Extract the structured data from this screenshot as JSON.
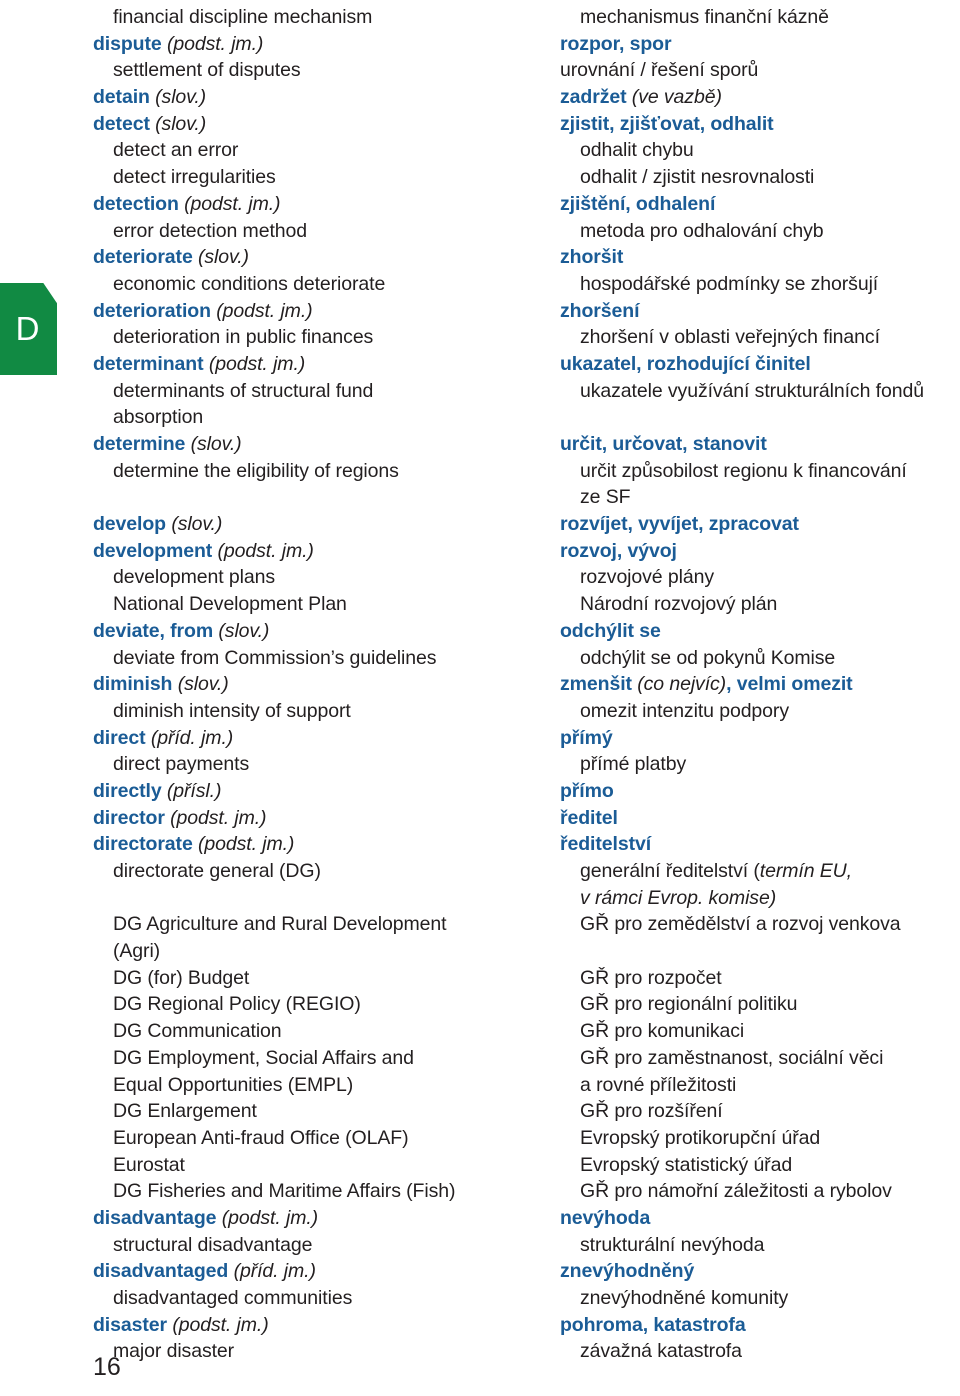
{
  "page": {
    "folio": "16",
    "thumb_index_letter": "D",
    "accent_blue": "#1b5c96",
    "tab_green": "#118a43",
    "body_color": "#231f20"
  },
  "rows": [
    {
      "en": [
        {
          "t": "financial discipline mechanism",
          "s": "plain"
        }
      ],
      "en_indent": true,
      "cs": [
        {
          "t": "mechanismus finanční kázně",
          "s": "plain"
        }
      ],
      "cs_indent": true
    },
    {
      "en": [
        {
          "t": "dispute",
          "s": "hw"
        },
        {
          "t": " (podst. jm.)",
          "s": "pos"
        }
      ],
      "en_indent": false,
      "cs": [
        {
          "t": "rozpor, spor",
          "s": "hw"
        }
      ],
      "cs_indent": false
    },
    {
      "en": [
        {
          "t": "settlement of disputes",
          "s": "plain"
        }
      ],
      "en_indent": true,
      "cs": [
        {
          "t": "urovnání / řešení sporů",
          "s": "plain"
        }
      ],
      "cs_indent": false
    },
    {
      "en": [
        {
          "t": "detain",
          "s": "hw"
        },
        {
          "t": " (slov.)",
          "s": "pos"
        }
      ],
      "en_indent": false,
      "cs": [
        {
          "t": "zadržet",
          "s": "hw"
        },
        {
          "t": " (ve vazbě)",
          "s": "pos"
        }
      ],
      "cs_indent": false
    },
    {
      "en": [
        {
          "t": "detect",
          "s": "hw"
        },
        {
          "t": " (slov.)",
          "s": "pos"
        }
      ],
      "en_indent": false,
      "cs": [
        {
          "t": "zjistit, zjišťovat, odhalit",
          "s": "hw"
        }
      ],
      "cs_indent": false
    },
    {
      "en": [
        {
          "t": "detect an error",
          "s": "plain"
        }
      ],
      "en_indent": true,
      "cs": [
        {
          "t": "odhalit chybu",
          "s": "plain"
        }
      ],
      "cs_indent": true
    },
    {
      "en": [
        {
          "t": "detect irregularities",
          "s": "plain"
        }
      ],
      "en_indent": true,
      "cs": [
        {
          "t": "odhalit / zjistit nesrovnalosti",
          "s": "plain"
        }
      ],
      "cs_indent": true
    },
    {
      "en": [
        {
          "t": "detection",
          "s": "hw"
        },
        {
          "t": " (podst. jm.)",
          "s": "pos"
        }
      ],
      "en_indent": false,
      "cs": [
        {
          "t": "zjištění, odhalení",
          "s": "hw"
        }
      ],
      "cs_indent": false
    },
    {
      "en": [
        {
          "t": "error detection method",
          "s": "plain"
        }
      ],
      "en_indent": true,
      "cs": [
        {
          "t": "metoda pro odhalování chyb",
          "s": "plain"
        }
      ],
      "cs_indent": true
    },
    {
      "en": [
        {
          "t": "deteriorate",
          "s": "hw"
        },
        {
          "t": " (slov.)",
          "s": "pos"
        }
      ],
      "en_indent": false,
      "cs": [
        {
          "t": "zhoršit",
          "s": "hw"
        }
      ],
      "cs_indent": false
    },
    {
      "en": [
        {
          "t": "economic conditions deteriorate",
          "s": "plain"
        }
      ],
      "en_indent": true,
      "cs": [
        {
          "t": "hospodářské podmínky se zhoršují",
          "s": "plain"
        }
      ],
      "cs_indent": true
    },
    {
      "en": [
        {
          "t": "deterioration",
          "s": "hw"
        },
        {
          "t": " (podst. jm.)",
          "s": "pos"
        }
      ],
      "en_indent": false,
      "cs": [
        {
          "t": "zhoršení",
          "s": "hw"
        }
      ],
      "cs_indent": false
    },
    {
      "en": [
        {
          "t": "deterioration in public finances",
          "s": "plain"
        }
      ],
      "en_indent": true,
      "cs": [
        {
          "t": "zhoršení v oblasti veřejných financí",
          "s": "plain"
        }
      ],
      "cs_indent": true
    },
    {
      "en": [
        {
          "t": "determinant",
          "s": "hw"
        },
        {
          "t": " (podst. jm.)",
          "s": "pos"
        }
      ],
      "en_indent": false,
      "cs": [
        {
          "t": "ukazatel, rozhodující činitel",
          "s": "hw"
        }
      ],
      "cs_indent": false
    },
    {
      "en": [
        {
          "t": "determinants of structural fund",
          "s": "plain"
        }
      ],
      "en_indent": true,
      "cs": [
        {
          "t": "ukazatele využívání strukturálních fondů",
          "s": "plain"
        }
      ],
      "cs_indent": true
    },
    {
      "en": [
        {
          "t": "absorption",
          "s": "plain"
        }
      ],
      "en_indent": true,
      "cs": [],
      "cs_indent": true
    },
    {
      "en": [
        {
          "t": "determine",
          "s": "hw"
        },
        {
          "t": " (slov.)",
          "s": "pos"
        }
      ],
      "en_indent": false,
      "cs": [
        {
          "t": "určit, určovat, stanovit",
          "s": "hw"
        }
      ],
      "cs_indent": false
    },
    {
      "en": [
        {
          "t": "determine the eligibility of regions",
          "s": "plain"
        }
      ],
      "en_indent": true,
      "cs": [
        {
          "t": "určit způsobilost regionu k financování",
          "s": "plain"
        }
      ],
      "cs_indent": true
    },
    {
      "en": [],
      "en_indent": true,
      "cs": [
        {
          "t": "ze SF",
          "s": "plain"
        }
      ],
      "cs_indent": true
    },
    {
      "en": [
        {
          "t": "develop",
          "s": "hw"
        },
        {
          "t": " (slov.)",
          "s": "pos"
        }
      ],
      "en_indent": false,
      "cs": [
        {
          "t": "rozvíjet, vyvíjet, zpracovat",
          "s": "hw"
        }
      ],
      "cs_indent": false
    },
    {
      "en": [
        {
          "t": "development",
          "s": "hw"
        },
        {
          "t": " (podst. jm.)",
          "s": "pos"
        }
      ],
      "en_indent": false,
      "cs": [
        {
          "t": "rozvoj, vývoj",
          "s": "hw"
        }
      ],
      "cs_indent": false
    },
    {
      "en": [
        {
          "t": "development plans",
          "s": "plain"
        }
      ],
      "en_indent": true,
      "cs": [
        {
          "t": "rozvojové plány",
          "s": "plain"
        }
      ],
      "cs_indent": true
    },
    {
      "en": [
        {
          "t": "National Development Plan",
          "s": "plain"
        }
      ],
      "en_indent": true,
      "cs": [
        {
          "t": "Národní rozvojový plán",
          "s": "plain"
        }
      ],
      "cs_indent": true
    },
    {
      "en": [
        {
          "t": "deviate, from",
          "s": "hw"
        },
        {
          "t": " (slov.)",
          "s": "pos"
        }
      ],
      "en_indent": false,
      "cs": [
        {
          "t": "odchýlit se",
          "s": "hw"
        }
      ],
      "cs_indent": false
    },
    {
      "en": [
        {
          "t": "deviate from Commission’s guidelines",
          "s": "plain"
        }
      ],
      "en_indent": true,
      "cs": [
        {
          "t": "odchýlit se od pokynů Komise",
          "s": "plain"
        }
      ],
      "cs_indent": true
    },
    {
      "en": [
        {
          "t": "diminish",
          "s": "hw"
        },
        {
          "t": " (slov.)",
          "s": "pos"
        }
      ],
      "en_indent": false,
      "cs": [
        {
          "t": "zmenšit",
          "s": "hw"
        },
        {
          "t": " (co nejvíc)",
          "s": "pos"
        },
        {
          "t": ", ",
          "s": "hw"
        },
        {
          "t": "velmi omezit",
          "s": "hw"
        }
      ],
      "cs_indent": false
    },
    {
      "en": [
        {
          "t": "diminish intensity of support",
          "s": "plain"
        }
      ],
      "en_indent": true,
      "cs": [
        {
          "t": "omezit intenzitu podpory",
          "s": "plain"
        }
      ],
      "cs_indent": true
    },
    {
      "en": [
        {
          "t": "direct",
          "s": "hw"
        },
        {
          "t": " (příd. jm.)",
          "s": "pos"
        }
      ],
      "en_indent": false,
      "cs": [
        {
          "t": "přímý",
          "s": "hw"
        }
      ],
      "cs_indent": false
    },
    {
      "en": [
        {
          "t": "direct payments",
          "s": "plain"
        }
      ],
      "en_indent": true,
      "cs": [
        {
          "t": "přímé platby",
          "s": "plain"
        }
      ],
      "cs_indent": true
    },
    {
      "en": [
        {
          "t": "directly",
          "s": "hw"
        },
        {
          "t": " (přísl.)",
          "s": "pos"
        }
      ],
      "en_indent": false,
      "cs": [
        {
          "t": "přímo",
          "s": "hw"
        }
      ],
      "cs_indent": false
    },
    {
      "en": [
        {
          "t": "director",
          "s": "hw"
        },
        {
          "t": " (podst. jm.)",
          "s": "pos"
        }
      ],
      "en_indent": false,
      "cs": [
        {
          "t": "ředitel",
          "s": "hw"
        }
      ],
      "cs_indent": false
    },
    {
      "en": [
        {
          "t": "directorate",
          "s": "hw"
        },
        {
          "t": " (podst. jm.)",
          "s": "pos"
        }
      ],
      "en_indent": false,
      "cs": [
        {
          "t": "ředitelství",
          "s": "hw"
        }
      ],
      "cs_indent": false
    },
    {
      "en": [
        {
          "t": "directorate general (DG)",
          "s": "plain"
        }
      ],
      "en_indent": true,
      "cs": [
        {
          "t": "generální ředitelství (",
          "s": "plain"
        },
        {
          "t": "termín EU,",
          "s": "it"
        }
      ],
      "cs_indent": true
    },
    {
      "en": [],
      "en_indent": true,
      "cs": [
        {
          "t": "v rámci Evrop. komise)",
          "s": "it"
        }
      ],
      "cs_indent": true
    },
    {
      "en": [
        {
          "t": "DG Agriculture and Rural Development",
          "s": "plain"
        }
      ],
      "en_indent": true,
      "cs": [
        {
          "t": "GŘ pro zemědělství a rozvoj venkova",
          "s": "plain"
        }
      ],
      "cs_indent": true
    },
    {
      "en": [
        {
          "t": "(Agri)",
          "s": "plain"
        }
      ],
      "en_indent": true,
      "cs": [],
      "cs_indent": true
    },
    {
      "en": [
        {
          "t": "DG (for) Budget",
          "s": "plain"
        }
      ],
      "en_indent": true,
      "cs": [
        {
          "t": "GŘ pro rozpočet",
          "s": "plain"
        }
      ],
      "cs_indent": true
    },
    {
      "en": [
        {
          "t": "DG Regional Policy (REGIO)",
          "s": "plain"
        }
      ],
      "en_indent": true,
      "cs": [
        {
          "t": "GŘ pro regionální politiku",
          "s": "plain"
        }
      ],
      "cs_indent": true
    },
    {
      "en": [
        {
          "t": "DG Communication",
          "s": "plain"
        }
      ],
      "en_indent": true,
      "cs": [
        {
          "t": "GŘ pro komunikaci",
          "s": "plain"
        }
      ],
      "cs_indent": true
    },
    {
      "en": [
        {
          "t": "DG Employment, Social Affairs and",
          "s": "plain"
        }
      ],
      "en_indent": true,
      "cs": [
        {
          "t": "GŘ pro zaměstnanost, sociální věci",
          "s": "plain"
        }
      ],
      "cs_indent": true
    },
    {
      "en": [
        {
          "t": "Equal Opportunities (EMPL)",
          "s": "plain"
        }
      ],
      "en_indent": true,
      "cs": [
        {
          "t": "a rovné příležitosti",
          "s": "plain"
        }
      ],
      "cs_indent": true
    },
    {
      "en": [
        {
          "t": "DG Enlargement",
          "s": "plain"
        }
      ],
      "en_indent": true,
      "cs": [
        {
          "t": "GŘ pro rozšíření",
          "s": "plain"
        }
      ],
      "cs_indent": true
    },
    {
      "en": [
        {
          "t": "European Anti-fraud Office (OLAF)",
          "s": "plain"
        }
      ],
      "en_indent": true,
      "cs": [
        {
          "t": "Evropský protikorupční úřad",
          "s": "plain"
        }
      ],
      "cs_indent": true
    },
    {
      "en": [
        {
          "t": "Eurostat",
          "s": "plain"
        }
      ],
      "en_indent": true,
      "cs": [
        {
          "t": "Evropský statistický úřad",
          "s": "plain"
        }
      ],
      "cs_indent": true
    },
    {
      "en": [
        {
          "t": "DG Fisheries and Maritime Affairs (Fish)",
          "s": "plain"
        }
      ],
      "en_indent": true,
      "cs": [
        {
          "t": "GŘ pro námořní záležitosti a rybolov",
          "s": "plain"
        }
      ],
      "cs_indent": true
    },
    {
      "en": [
        {
          "t": "disadvantage",
          "s": "hw"
        },
        {
          "t": " (podst. jm.)",
          "s": "pos"
        }
      ],
      "en_indent": false,
      "cs": [
        {
          "t": "nevýhoda",
          "s": "hw"
        }
      ],
      "cs_indent": false
    },
    {
      "en": [
        {
          "t": "structural disadvantage",
          "s": "plain"
        }
      ],
      "en_indent": true,
      "cs": [
        {
          "t": "strukturální nevýhoda",
          "s": "plain"
        }
      ],
      "cs_indent": true
    },
    {
      "en": [
        {
          "t": "disadvantaged",
          "s": "hw"
        },
        {
          "t": " (příd. jm.)",
          "s": "pos"
        }
      ],
      "en_indent": false,
      "cs": [
        {
          "t": "znevýhodněný",
          "s": "hw"
        }
      ],
      "cs_indent": false
    },
    {
      "en": [
        {
          "t": "disadvantaged communities",
          "s": "plain"
        }
      ],
      "en_indent": true,
      "cs": [
        {
          "t": "znevýhodněné komunity",
          "s": "plain"
        }
      ],
      "cs_indent": true
    },
    {
      "en": [
        {
          "t": "disaster",
          "s": "hw"
        },
        {
          "t": " (podst. jm.)",
          "s": "pos"
        }
      ],
      "en_indent": false,
      "cs": [
        {
          "t": "pohroma, katastrofa",
          "s": "hw"
        }
      ],
      "cs_indent": false
    },
    {
      "en": [
        {
          "t": "major disaster",
          "s": "plain"
        }
      ],
      "en_indent": true,
      "cs": [
        {
          "t": "závažná katastrofa",
          "s": "plain"
        }
      ],
      "cs_indent": true
    }
  ]
}
